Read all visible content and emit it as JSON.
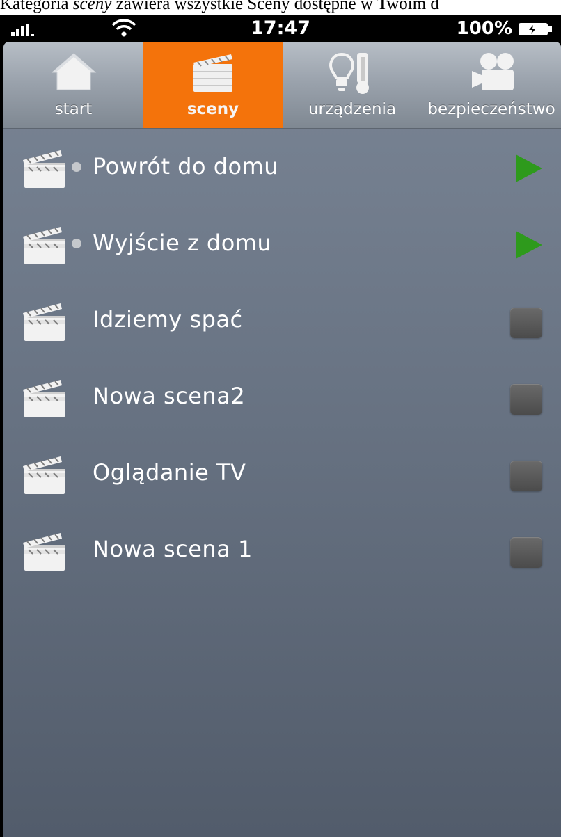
{
  "caption": {
    "part1": "Kategoria ",
    "italic": "sceny",
    "part2": " zawiera wszystkie Sceny dostępne w Twoim d"
  },
  "status_bar": {
    "time": "17:47",
    "battery": "100%",
    "icons": [
      "signal-icon",
      "wifi-icon",
      "battery-icon"
    ]
  },
  "tabs": [
    {
      "label": "start",
      "icon": "house-icon",
      "active": false
    },
    {
      "label": "sceny",
      "icon": "clapperboard-icon",
      "active": true
    },
    {
      "label": "urządzenia",
      "icon": "bulb-thermometer-icon",
      "active": false
    },
    {
      "label": "bezpieczeństwo",
      "icon": "camera-icon",
      "active": false
    }
  ],
  "scenes": [
    {
      "label": "Powrót do domu",
      "active_dot": true,
      "action": "play"
    },
    {
      "label": "Wyjście z domu",
      "active_dot": true,
      "action": "play"
    },
    {
      "label": "Idziemy spać",
      "active_dot": false,
      "action": "stop"
    },
    {
      "label": "Nowa scena2",
      "active_dot": false,
      "action": "stop"
    },
    {
      "label": "Oglądanie TV",
      "active_dot": false,
      "action": "stop"
    },
    {
      "label": "Nowa scena 1",
      "active_dot": false,
      "action": "stop"
    }
  ],
  "colors": {
    "accent": "#f4730b",
    "play": "#2e9a1c",
    "background": "#6a7585"
  }
}
